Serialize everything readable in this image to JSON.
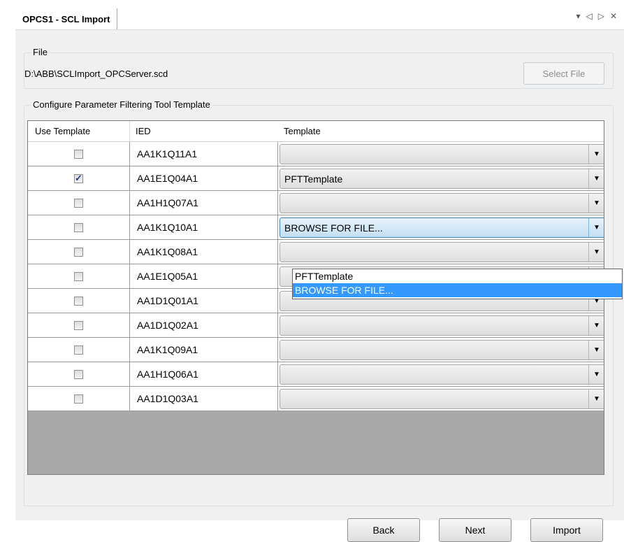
{
  "tab": {
    "title": "OPCS1 - SCL Import"
  },
  "tab_controls": {
    "dropdown": "▾",
    "prev": "◁",
    "next": "▷",
    "close": "✕"
  },
  "file_group": {
    "legend": "File",
    "path": "D:\\ABB\\SCLImport_OPCServer.scd",
    "select_button": "Select File"
  },
  "config_group": {
    "legend": "Configure Parameter Filtering Tool Template"
  },
  "grid": {
    "headers": {
      "use_template": "Use Template",
      "ied": "IED",
      "template": "Template"
    },
    "rows": [
      {
        "checked": false,
        "ied": "AA1K1Q11A1",
        "template": ""
      },
      {
        "checked": true,
        "ied": "AA1E1Q04A1",
        "template": "PFTTemplate"
      },
      {
        "checked": false,
        "ied": "AA1H1Q07A1",
        "template": ""
      },
      {
        "checked": false,
        "ied": "AA1K1Q10A1",
        "template": "BROWSE FOR FILE..."
      },
      {
        "checked": false,
        "ied": "AA1K1Q08A1",
        "template": ""
      },
      {
        "checked": false,
        "ied": "AA1E1Q05A1",
        "template": ""
      },
      {
        "checked": false,
        "ied": "AA1D1Q01A1",
        "template": ""
      },
      {
        "checked": false,
        "ied": "AA1D1Q02A1",
        "template": ""
      },
      {
        "checked": false,
        "ied": "AA1K1Q09A1",
        "template": ""
      },
      {
        "checked": false,
        "ied": "AA1H1Q06A1",
        "template": ""
      },
      {
        "checked": false,
        "ied": "AA1D1Q03A1",
        "template": ""
      }
    ],
    "open_dropdown": {
      "options": [
        "PFTTemplate",
        "BROWSE FOR FILE..."
      ],
      "selected": "BROWSE FOR FILE..."
    }
  },
  "buttons": {
    "back": "Back",
    "next": "Next",
    "import": "Import"
  },
  "colors": {
    "selection": "#3399ff",
    "grid_empty": "#a9a9a9",
    "panel": "#f0f0f0"
  }
}
